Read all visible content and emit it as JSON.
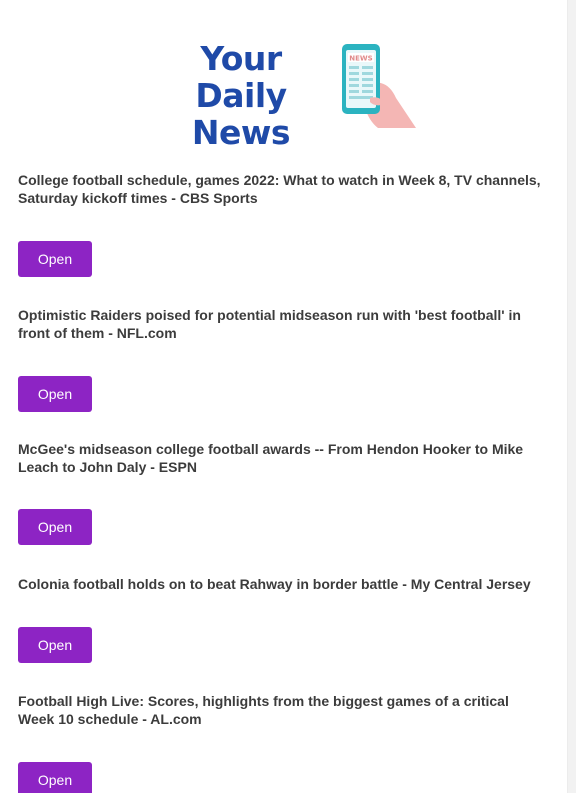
{
  "header": {
    "logo_line1": "Your Daily",
    "logo_line2": "News",
    "phone_screen_label": "NEWS"
  },
  "colors": {
    "brand_blue": "#1f4aa8",
    "button_purple": "#8d24c4",
    "headline_text": "#3c3c3c",
    "phone_teal": "#2bb3c0",
    "hand_pink": "#f4b6b4"
  },
  "items": [
    {
      "headline": "College football schedule, games 2022: What to watch in Week 8, TV channels, Saturday kickoff times - CBS Sports",
      "button_label": "Open"
    },
    {
      "headline": "Optimistic Raiders poised for potential midseason run with 'best football' in front of them - NFL.com",
      "button_label": "Open"
    },
    {
      "headline": "McGee's midseason college football awards -- From Hendon Hooker to Mike Leach to John Daly - ESPN",
      "button_label": "Open"
    },
    {
      "headline": "Colonia football holds on to beat Rahway in border battle - My Central Jersey",
      "button_label": "Open"
    },
    {
      "headline": "Football High Live: Scores, highlights from the biggest games of a critical Week 10 schedule - AL.com",
      "button_label": "Open"
    }
  ]
}
